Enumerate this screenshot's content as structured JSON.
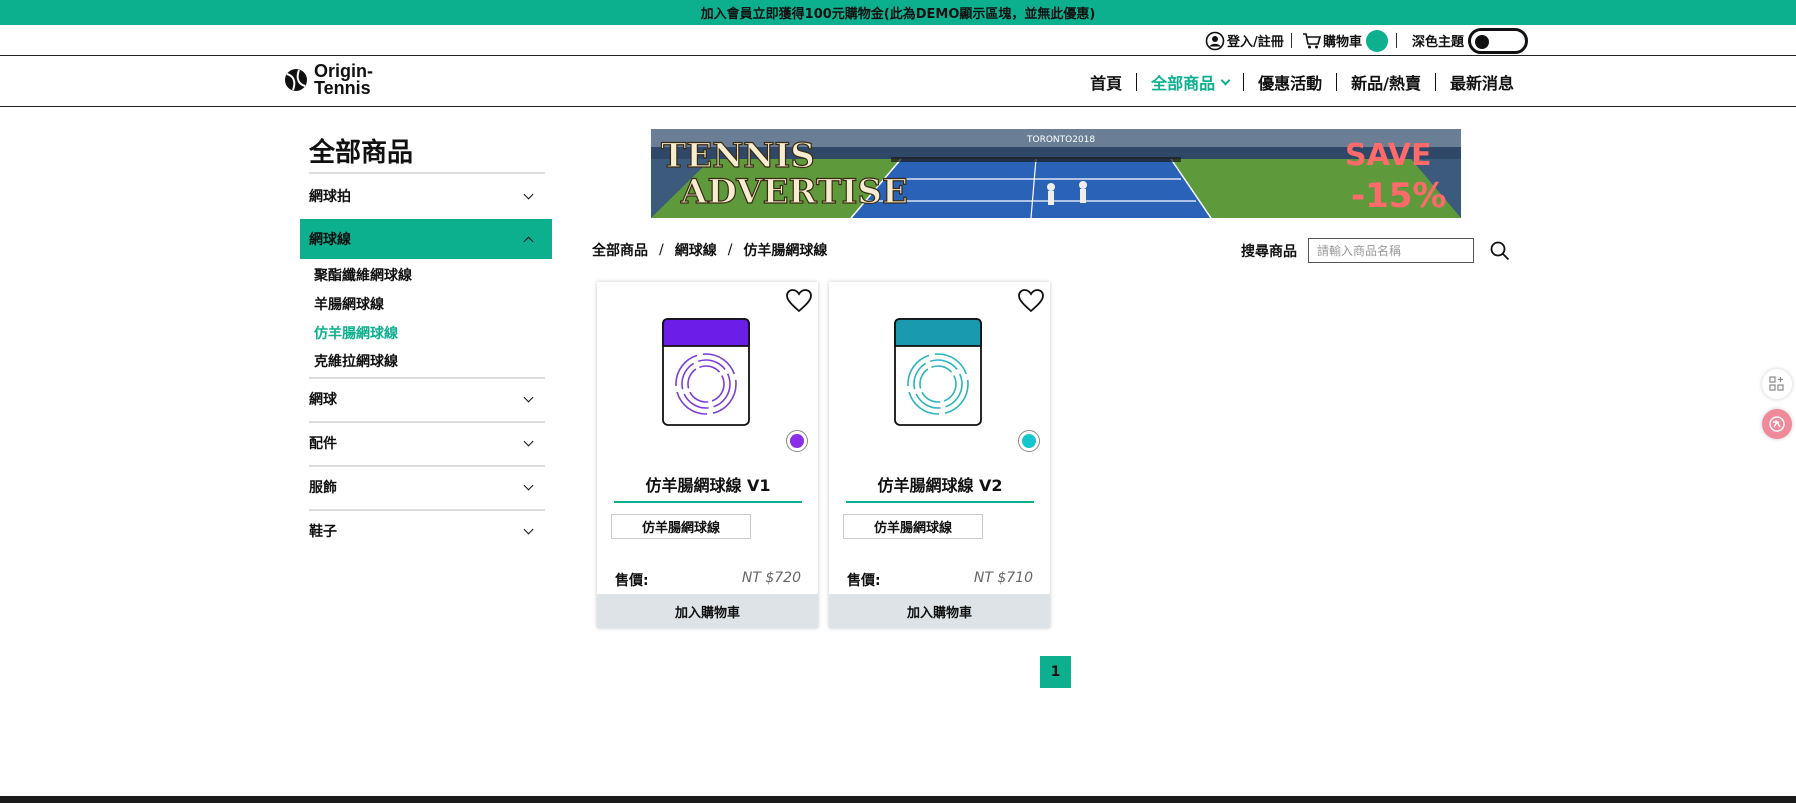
{
  "promo_text": "加入會員立即獲得100元購物金(此為DEMO顯示區塊，並無此優惠)",
  "utility": {
    "login_label": "登入/註冊",
    "cart_label": "購物車",
    "theme_label": "深色主題",
    "accent": "#0cb08f"
  },
  "logo": {
    "line1": "Origin-",
    "line2": "Tennis"
  },
  "nav": {
    "items": [
      "首頁",
      "全部商品",
      "優惠活動",
      "新品/熱賣",
      "最新消息"
    ],
    "active": "全部商品"
  },
  "sidebar": {
    "title": "全部商品",
    "categories": [
      {
        "label": "網球拍",
        "expanded": false
      },
      {
        "label": "網球線",
        "expanded": true,
        "sub": [
          "聚酯纖維網球線",
          "羊腸網球線",
          "仿羊腸網球線",
          "克維拉網球線"
        ],
        "active_sub": "仿羊腸網球線"
      },
      {
        "label": "網球",
        "expanded": false
      },
      {
        "label": "配件",
        "expanded": false
      },
      {
        "label": "服飾",
        "expanded": false
      },
      {
        "label": "鞋子",
        "expanded": false
      }
    ]
  },
  "banner": {
    "line1": "TENNIS",
    "line2": "ADVERTISE",
    "promo1": "SAVE",
    "promo2": "-15%",
    "sign": "TORONTO2018"
  },
  "breadcrumb": [
    "全部商品",
    "網球線",
    "仿羊腸網球線"
  ],
  "search": {
    "label": "搜尋商品",
    "placeholder": "請輸入商品名稱"
  },
  "products": [
    {
      "name": "仿羊腸網球線 V1",
      "tag": "仿羊腸網球線",
      "price_label": "售價:",
      "price": "NT $720",
      "cart_label": "加入購物車",
      "color": "#6a1ee8",
      "swatch": "#8a2ee8"
    },
    {
      "name": "仿羊腸網球線 V2",
      "tag": "仿羊腸網球線",
      "price_label": "售價:",
      "price": "NT $710",
      "cart_label": "加入購物車",
      "color": "#1a9aae",
      "swatch": "#16c6cc"
    }
  ],
  "pagination": {
    "current": "1"
  }
}
